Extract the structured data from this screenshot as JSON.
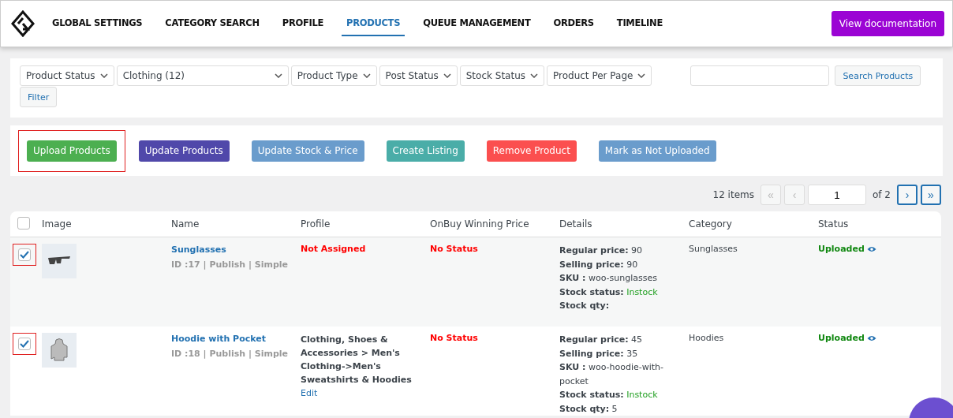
{
  "nav": {
    "tabs": [
      {
        "label": "GLOBAL SETTINGS",
        "selected": false
      },
      {
        "label": "CATEGORY SEARCH",
        "selected": false
      },
      {
        "label": "PROFILE",
        "selected": false
      },
      {
        "label": "PRODUCTS",
        "selected": true
      },
      {
        "label": "QUEUE MANAGEMENT",
        "selected": false
      },
      {
        "label": "ORDERS",
        "selected": false
      },
      {
        "label": "TIMELINE",
        "selected": false
      }
    ],
    "doc_button": "View documentation"
  },
  "filters": {
    "dropdowns": [
      {
        "label": "Product Status",
        "wide": false
      },
      {
        "label": "Clothing  (12)",
        "wide": true
      },
      {
        "label": "Product Type",
        "wide": false
      },
      {
        "label": "Post Status",
        "wide": false
      },
      {
        "label": "Stock Status",
        "wide": false
      },
      {
        "label": "Product Per Page",
        "wide": false
      }
    ],
    "search_button": "Search Products",
    "filter_button": "Filter"
  },
  "actions": [
    {
      "label": "Upload Products",
      "color": "#4caf50",
      "highlighted": true
    },
    {
      "label": "Update Products",
      "color": "#5048aa",
      "highlighted": false
    },
    {
      "label": "Update Stock & Price",
      "color": "#6a9ccc",
      "highlighted": false
    },
    {
      "label": "Create Listing",
      "color": "#4aada8",
      "highlighted": false
    },
    {
      "label": "Remove Product",
      "color": "#fb4f4f",
      "highlighted": false
    },
    {
      "label": "Mark as Not Uploaded",
      "color": "#6a9ccc",
      "highlighted": false
    }
  ],
  "pagination": {
    "count": "12 items",
    "first": "«",
    "prev": "‹",
    "page": "1",
    "of": "of 2",
    "next": "›",
    "last": "»"
  },
  "table": {
    "header_checked": false,
    "columns": [
      "Image",
      "Name",
      "Profile",
      "OnBuy Winning Price",
      "Details",
      "Category",
      "Status"
    ],
    "rows": [
      {
        "checked": true,
        "highlighted": true,
        "name": "Sunglasses",
        "meta": "ID :17 | Publish | Simple",
        "profile": "Not Assigned",
        "profile_assigned": false,
        "price": "No Status",
        "details": [
          {
            "label": "Regular price:",
            "value": "90",
            "kind": "plain"
          },
          {
            "label": "Selling price:",
            "value": "90",
            "kind": "plain"
          },
          {
            "label": "SKU :",
            "value": "woo-sunglasses",
            "kind": "plain"
          },
          {
            "label": "Stock status:",
            "value": "Instock",
            "kind": "stock"
          },
          {
            "label": "Stock qty:",
            "kind": "plain"
          }
        ],
        "category": "Sunglasses",
        "status": "Uploaded"
      },
      {
        "checked": true,
        "highlighted": true,
        "name": "Hoodie with Pocket",
        "meta": "ID :18 | Publish | Simple",
        "profile": "Clothing, Shoes & Accessories > Men's Clothing->Men's Sweatshirts & Hoodies",
        "profile_assigned": true,
        "profile_link": "Edit",
        "price": "No Status",
        "details": [
          {
            "label": "Regular price:",
            "value": "45",
            "kind": "plain"
          },
          {
            "label": "Selling price:",
            "value": "35",
            "kind": "plain"
          },
          {
            "label": "SKU :",
            "value": "woo-hoodie-with-pocket",
            "kind": "plain"
          },
          {
            "label": "Stock status:",
            "value": "Instock",
            "kind": "stock"
          },
          {
            "label": "Stock qty:",
            "value": "5",
            "kind": "plain"
          }
        ],
        "category": "Hoodies",
        "status": "Uploaded"
      }
    ]
  }
}
